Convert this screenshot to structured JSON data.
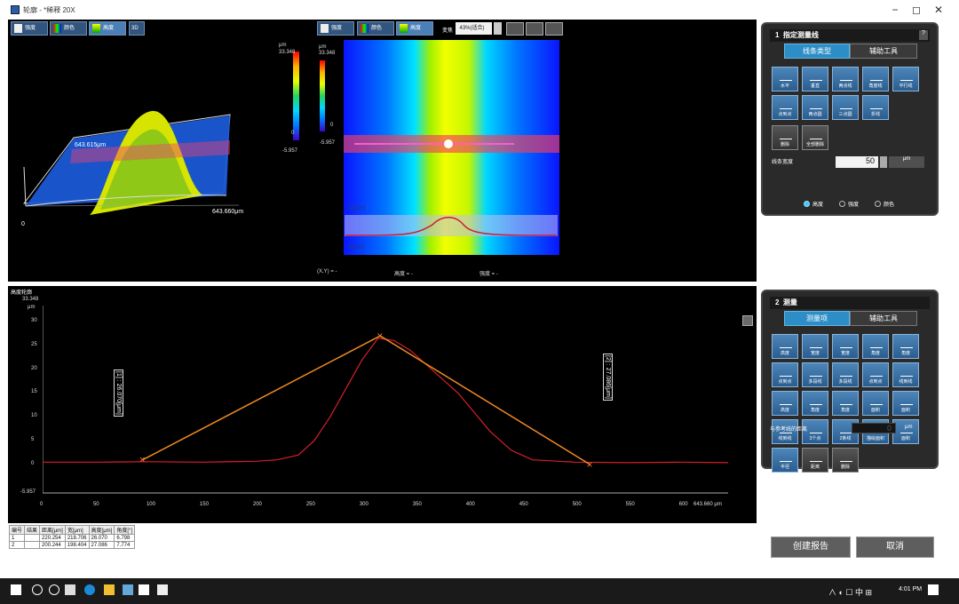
{
  "window": {
    "title": "轮廓 - *稀释 20X",
    "minimize": "−",
    "maximize": "◻",
    "close": "✕"
  },
  "view_toolbar": {
    "buttons": [
      "强度",
      "颜色",
      "高度",
      "3D"
    ]
  },
  "top_toolbar": {
    "buttons": [
      "强度",
      "颜色",
      "高度"
    ],
    "zoom_label": "变焦",
    "zoom_value": "43%(适合)"
  },
  "left_view": {
    "scale_unit": "μm",
    "scale_max": "33.348",
    "scale_zero": "0",
    "scale_min": "-5.957",
    "axis_label_depth": "643.615μm",
    "axis_label_width": "643.660μm",
    "origin": "0"
  },
  "center_view": {
    "scale_unit": "μm",
    "scale_max": "33.348",
    "scale_zero": "0",
    "scale_min": "-5.957",
    "profile_top": "33[μm]",
    "profile_bottom": "-6[μm]",
    "status_xy": "(X,Y) = -",
    "status_height": "高度 = -",
    "status_intensity": "强度 = -"
  },
  "panel1": {
    "number": "1",
    "title": "指定测量线",
    "help": "?",
    "tabs": [
      "线条类型",
      "辅助工具"
    ],
    "tools": [
      "水平",
      "垂直",
      "两点线",
      "角度线",
      "平行线",
      "点到点",
      "两点圆",
      "三点圆",
      "折线",
      "删除",
      "全部删除"
    ],
    "line_width_label": "线条宽度",
    "line_width_value": "50",
    "unit": "μm",
    "radio_options": [
      "高度",
      "强度",
      "颜色"
    ],
    "radio_selected": "高度"
  },
  "panel2": {
    "number": "2",
    "title": "测量",
    "tabs": [
      "测量项",
      "辅助工具"
    ],
    "tools": [
      "高度",
      "宽度",
      "宽度",
      "角度",
      "角度",
      "点到点",
      "多段线",
      "多段线",
      "点到点",
      "线到线",
      "高度",
      "角度",
      "角度",
      "面积",
      "面积",
      "线到线",
      "3个点",
      "2条线",
      "描绘面积",
      "面积",
      "半径",
      "距离",
      "删除",
      "全部删除"
    ],
    "ref_label": "与参考线的距离",
    "ref_value": "0",
    "unit": "μm"
  },
  "profile_chart": {
    "title": "高度轮廓",
    "y_max_label": "33.348",
    "y_unit": "μm",
    "y_ticks": [
      "30",
      "25",
      "20",
      "15",
      "10",
      "5",
      "0",
      "-5.957"
    ],
    "x_ticks": [
      "0",
      "50",
      "100",
      "150",
      "200",
      "250",
      "300",
      "350",
      "400",
      "450",
      "500",
      "550",
      "600",
      "643.660 μm"
    ],
    "left_dim": "[1] : 26.070[μm]",
    "right_dim": "[2] : 27.086[μm]"
  },
  "chart_data": {
    "type": "line",
    "title": "高度轮廓",
    "xlabel": "μm",
    "ylabel": "μm",
    "xlim": [
      0,
      643.66
    ],
    "ylim": [
      -5.957,
      33.348
    ],
    "series": [
      {
        "x": [
          0,
          50,
          100,
          150,
          200,
          220,
          240,
          255,
          270,
          285,
          300,
          315,
          330,
          345,
          360,
          375,
          390,
          405,
          420,
          440,
          460,
          500,
          550,
          600,
          643.66
        ],
        "y": [
          0.5,
          0.5,
          0.6,
          0.5,
          0.7,
          1.0,
          2.0,
          5.0,
          10.0,
          16.0,
          22.0,
          26.5,
          26.0,
          24.0,
          21.0,
          18.0,
          15.0,
          11.0,
          7.0,
          3.0,
          1.0,
          0.5,
          0.4,
          0.5,
          0.4
        ]
      },
      {
        "x": [
          94,
          317,
          514
        ],
        "y": [
          1.0,
          27.0,
          0.0
        ]
      }
    ]
  },
  "results_table": {
    "headers": [
      "编号",
      "结果",
      "距离[μm]",
      "宽[μm]",
      "高度[μm]",
      "角度[°]"
    ],
    "rows": [
      [
        "1",
        "",
        "220.254",
        "218.706",
        "26.070",
        "6.798"
      ],
      [
        "2",
        "",
        "200.244",
        "198.404",
        "27.086",
        "7.774"
      ]
    ]
  },
  "actions": {
    "create_report": "创建报告",
    "cancel": "取消"
  },
  "taskbar": {
    "time": "4:01 PM",
    "tray": "∧ ◐ ☐ 中 ⊞"
  }
}
